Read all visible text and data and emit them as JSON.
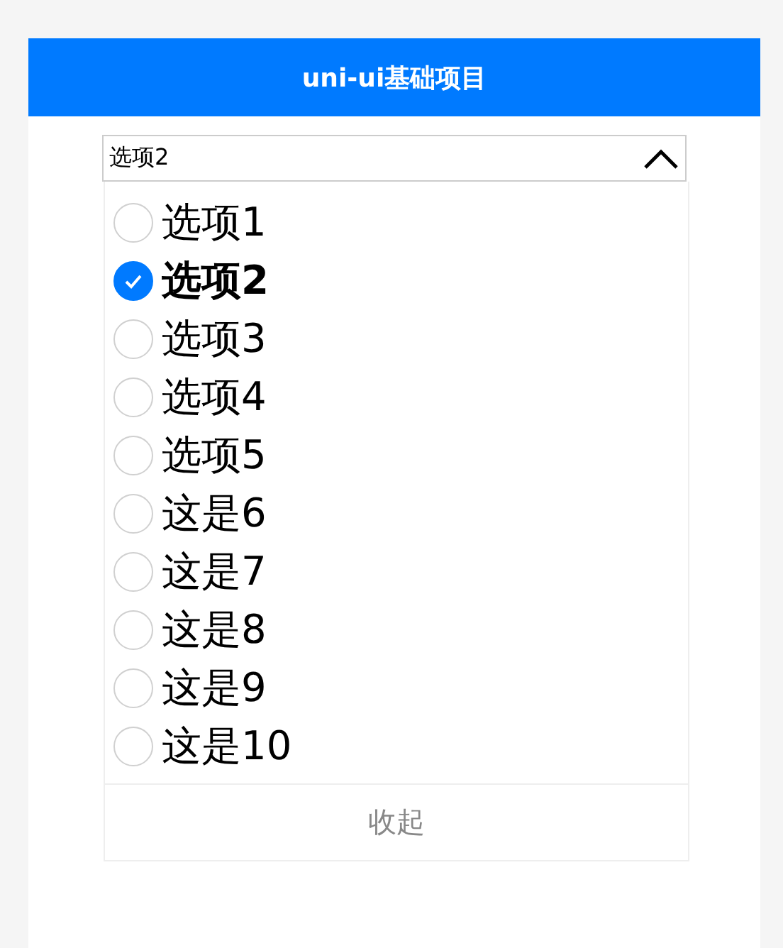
{
  "header": {
    "title": "uni-ui基础项目"
  },
  "select": {
    "value": "选项2",
    "expanded": true
  },
  "options": [
    {
      "label": "选项1",
      "selected": false
    },
    {
      "label": "选项2",
      "selected": true
    },
    {
      "label": "选项3",
      "selected": false
    },
    {
      "label": "选项4",
      "selected": false
    },
    {
      "label": "选项5",
      "selected": false
    },
    {
      "label": "这是6",
      "selected": false
    },
    {
      "label": "这是7",
      "selected": false
    },
    {
      "label": "这是8",
      "selected": false
    },
    {
      "label": "这是9",
      "selected": false
    },
    {
      "label": "这是10",
      "selected": false
    }
  ],
  "collapse_button": "收起"
}
